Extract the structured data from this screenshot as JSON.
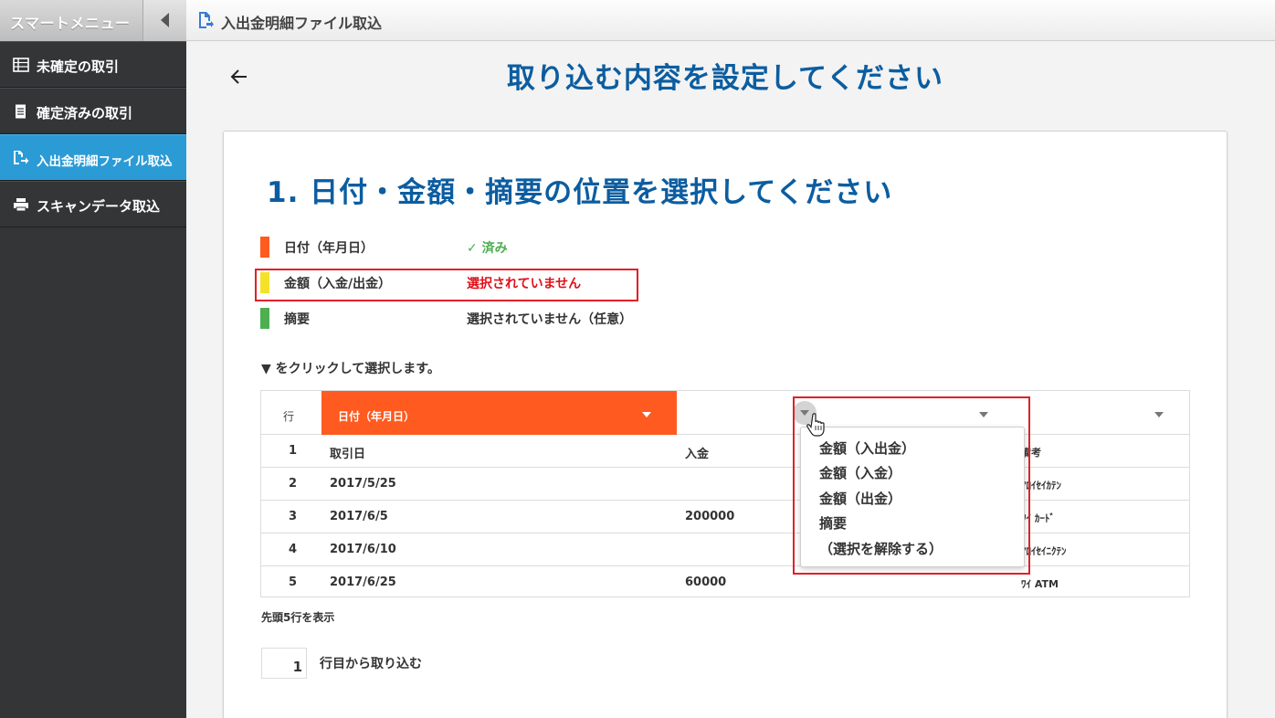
{
  "header": {
    "menu_label": "スマートメニュー",
    "page_tab": "入出金明細ファイル取込"
  },
  "sidebar": {
    "items": [
      {
        "label": "未確定の取引",
        "icon": "list-icon"
      },
      {
        "label": "確定済みの取引",
        "icon": "document-icon"
      },
      {
        "label": "入出金明細ファイル取込",
        "icon": "file-import-icon",
        "active": true
      },
      {
        "label": "スキャンデータ取込",
        "icon": "scanner-icon"
      }
    ]
  },
  "main": {
    "title": "取り込む内容を設定してください",
    "section_title": "1. 日付・金額・摘要の位置を選択してください",
    "legend": [
      {
        "label": "日付（年月日）",
        "status": "✓ 済み",
        "color": "#ff5a1f",
        "status_color": "#4caf50"
      },
      {
        "label": "金額（入金/出金）",
        "status": "選択されていません",
        "color": "#f5e228",
        "status_color": "#e0101a"
      },
      {
        "label": "摘要",
        "status": "選択されていません（任意）",
        "color": "#4caf50",
        "status_color": "#333333"
      }
    ],
    "instruction": "▼ をクリックして選択します。",
    "table": {
      "row_header": "行",
      "date_column_label": "日付（年月日）",
      "rows": [
        {
          "no": "1",
          "date": "取引日",
          "in": "入金",
          "note": "備考"
        },
        {
          "no": "2",
          "date": "2017/5/25",
          "in": "",
          "note": "ｱﾛｲｾｲｶﾃﾝ"
        },
        {
          "no": "3",
          "date": "2017/6/5",
          "in": "200000",
          "note": "ﾜｲ ｶｰﾄﾞ"
        },
        {
          "no": "4",
          "date": "2017/6/10",
          "in": "",
          "note": "ｱﾛｲｾｲﾆｸﾃﾝ"
        },
        {
          "no": "5",
          "date": "2017/6/25",
          "in": "60000",
          "note": "ﾜｲ ATM"
        }
      ]
    },
    "footnote": "先頭5行を表示",
    "start_row": {
      "value": "1",
      "label": "行目から取り込む"
    },
    "dropdown": {
      "options": [
        "金額（入出金）",
        "金額（入金）",
        "金額（出金）",
        "摘要",
        "（選択を解除する）"
      ]
    }
  }
}
